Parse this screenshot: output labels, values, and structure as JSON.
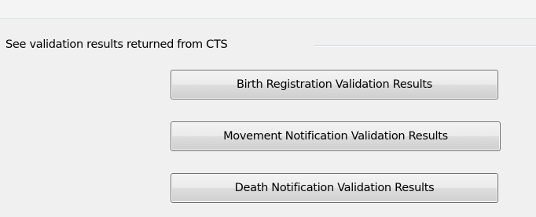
{
  "group": {
    "label": "See validation results returned from CTS"
  },
  "buttons": {
    "birth": "Birth Registration Validation Results",
    "movement": "Movement Notification Validation Results",
    "death": "Death Notification Validation Results"
  }
}
